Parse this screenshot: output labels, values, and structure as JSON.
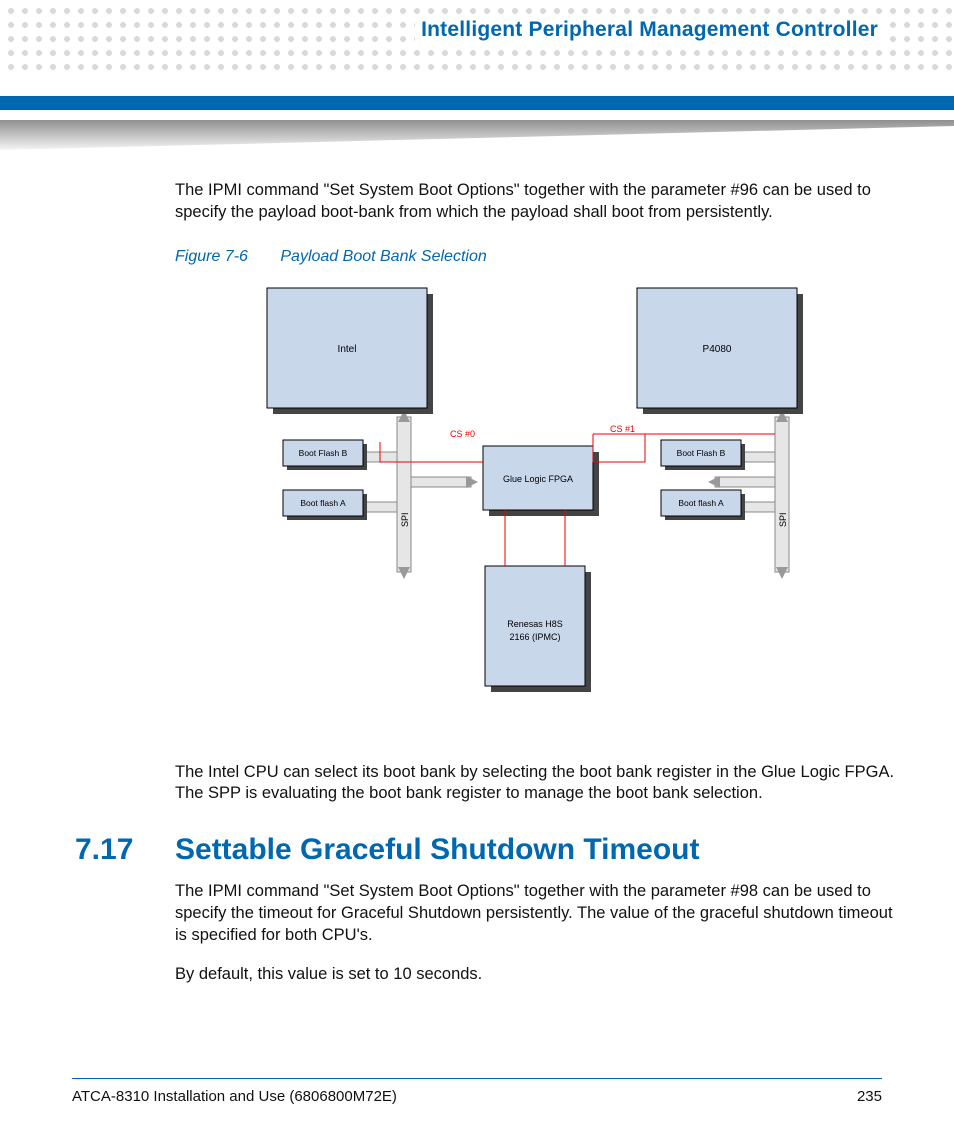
{
  "header": {
    "chapter_title": "Intelligent Peripheral Management Controller"
  },
  "para1": "The IPMI command \"Set System Boot Options\" together with the parameter #96 can be used to specify the payload boot-bank from which the payload shall boot from persistently.",
  "figure": {
    "number": "Figure 7-6",
    "title": "Payload Boot Bank Selection",
    "labels": {
      "intel": "Intel",
      "p4080": "P4080",
      "bfb_l": "Boot Flash B",
      "bfa_l": "Boot flash A",
      "bfb_r": "Boot Flash B",
      "bfa_r": "Boot flash A",
      "glue": "Glue Logic FPGA",
      "renesas_l1": "Renesas H8S",
      "renesas_l2": "2166 (IPMC)",
      "cs0": "CS #0",
      "cs1": "CS #1",
      "spi": "SPI"
    }
  },
  "para2": "The Intel CPU can select its boot bank by selecting the boot bank register in the Glue Logic FPGA. The SPP is evaluating the boot bank register to manage the boot bank selection.",
  "section": {
    "number": "7.17",
    "title": "Settable Graceful Shutdown Timeout"
  },
  "para3": "The IPMI command \"Set System Boot Options\" together with the parameter #98 can be used to specify the timeout for Graceful Shutdown persistently. The value of the graceful shutdown timeout is specified for both CPU's.",
  "para4": "By default, this value is set to 10 seconds.",
  "footer": {
    "doc": "ATCA-8310 Installation and Use (6806800M72E)",
    "page": "235"
  }
}
